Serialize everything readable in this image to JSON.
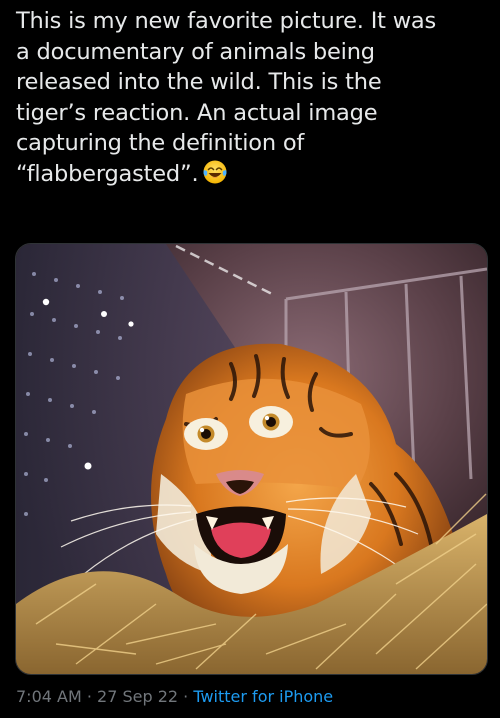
{
  "tweet": {
    "lines": [
      "This is my new favorite picture. It was",
      "a documentary of animals being",
      "released into the wild. This is the",
      "tiger’s reaction. An actual image",
      "capturing the definition of",
      "“flabbergasted”."
    ],
    "emoji": "face-with-tears-of-joy-icon"
  },
  "media": {
    "type": "photo",
    "subject": "tiger-in-crate"
  },
  "meta": {
    "time": "7:04 AM",
    "sep1": " · ",
    "date": "27 Sep 22",
    "sep2": " · ",
    "source": "Twitter for iPhone"
  },
  "colors": {
    "background": "#000000",
    "text": "#e7e9ea",
    "secondary_text": "#71767b",
    "link": "#1d9bf0"
  }
}
